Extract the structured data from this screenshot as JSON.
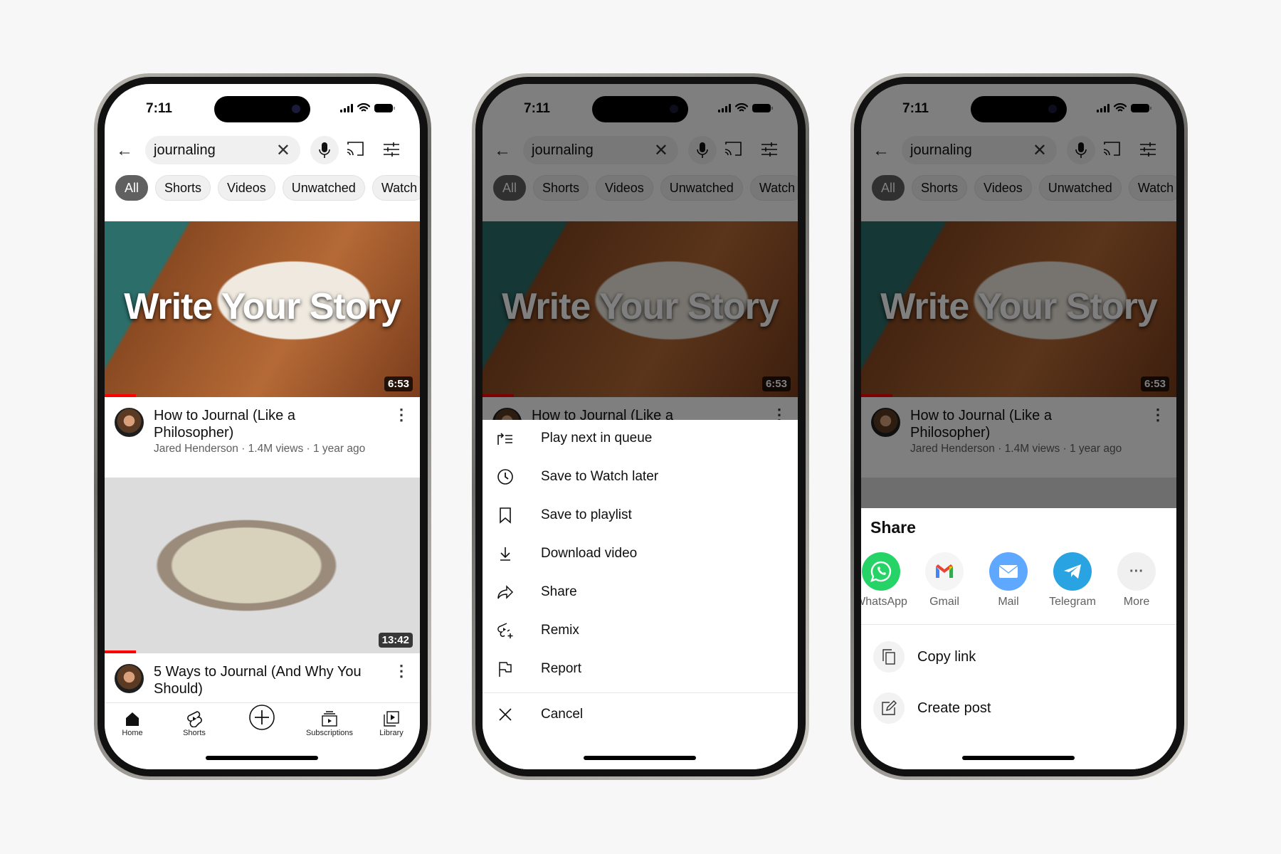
{
  "status": {
    "time": "7:11"
  },
  "search": {
    "query": "journaling"
  },
  "chips": [
    "All",
    "Shorts",
    "Videos",
    "Unwatched",
    "Watch"
  ],
  "videos": [
    {
      "thumb_text": "Write Your Story",
      "duration": "6:53",
      "title": "How to Journal (Like a Philosopher)",
      "meta": "Jared Henderson · 1.4M views · 1 year ago",
      "watched_fraction": 0.1
    },
    {
      "duration": "13:42",
      "title": "5 Ways to Journal (And Why You Should)",
      "watched_fraction": 0.1
    }
  ],
  "nav": {
    "home": "Home",
    "shorts": "Shorts",
    "subscriptions": "Subscriptions",
    "library": "Library"
  },
  "menu": {
    "items": [
      "Play next in queue",
      "Save to Watch later",
      "Save to playlist",
      "Download video",
      "Share",
      "Remix",
      "Report"
    ],
    "cancel": "Cancel"
  },
  "share": {
    "title": "Share",
    "apps": [
      {
        "label": "WhatsApp",
        "color": "#25d366"
      },
      {
        "label": "Gmail",
        "color": "#f5f5f5"
      },
      {
        "label": "Mail",
        "color": "#5ea8ff"
      },
      {
        "label": "Telegram",
        "color": "#2aa3e3"
      },
      {
        "label": "More",
        "color": "#f0f0f0"
      }
    ],
    "copy_link": "Copy link",
    "create_post": "Create post"
  },
  "colors": {
    "accent": "#ff0000",
    "chip_active": "#606060"
  }
}
